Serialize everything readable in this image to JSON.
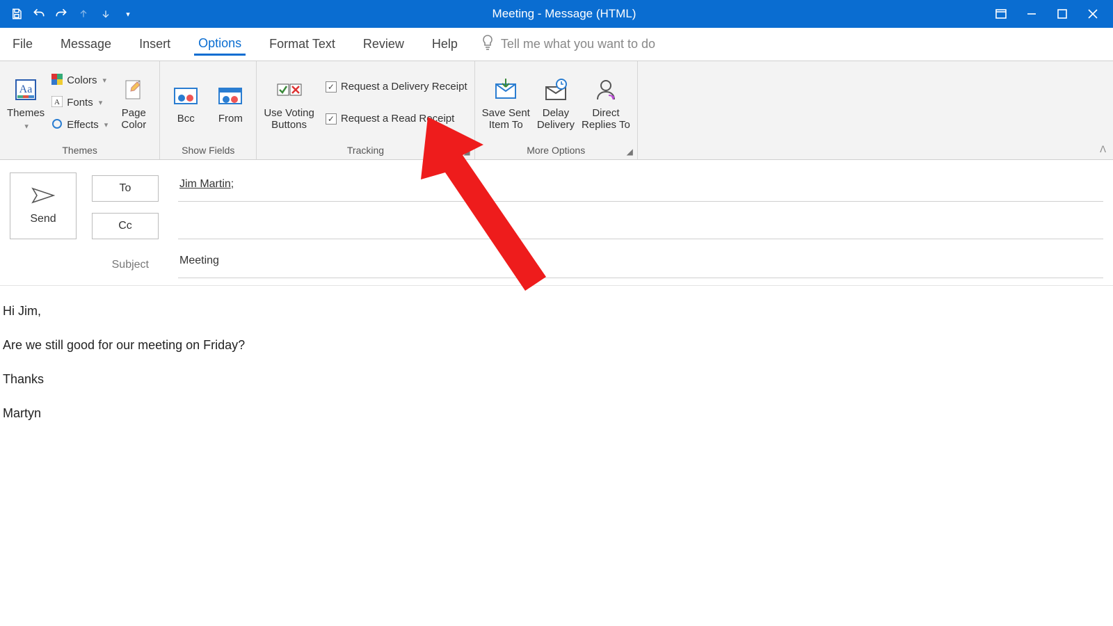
{
  "window": {
    "title": "Meeting - Message (HTML)"
  },
  "tabs": {
    "file": "File",
    "message": "Message",
    "insert": "Insert",
    "options": "Options",
    "format_text": "Format Text",
    "review": "Review",
    "help": "Help",
    "tell_me": "Tell me what you want to do"
  },
  "ribbon": {
    "themes": {
      "label": "Themes",
      "themes_btn": "Themes",
      "colors": "Colors",
      "fonts": "Fonts",
      "effects": "Effects",
      "page_color": "Page\nColor"
    },
    "show_fields": {
      "label": "Show Fields",
      "bcc": "Bcc",
      "from": "From"
    },
    "tracking": {
      "label": "Tracking",
      "voting": "Use Voting\nButtons",
      "delivery_receipt": "Request a Delivery Receipt",
      "read_receipt": "Request a Read Receipt",
      "delivery_checked": true,
      "read_checked": true
    },
    "more_options": {
      "label": "More Options",
      "save_sent": "Save Sent\nItem To",
      "delay": "Delay\nDelivery",
      "direct": "Direct\nReplies To"
    }
  },
  "compose": {
    "send": "Send",
    "to_label": "To",
    "cc_label": "Cc",
    "subject_label": "Subject",
    "to_value": "Jim Martin",
    "cc_value": "",
    "subject_value": "Meeting"
  },
  "body": {
    "line1": "Hi Jim,",
    "line2": "Are we still good for our meeting on Friday?",
    "line3": "Thanks",
    "line4": "Martyn"
  },
  "colors": {
    "accent": "#0a6dd1",
    "arrow": "#ee1c1c"
  }
}
